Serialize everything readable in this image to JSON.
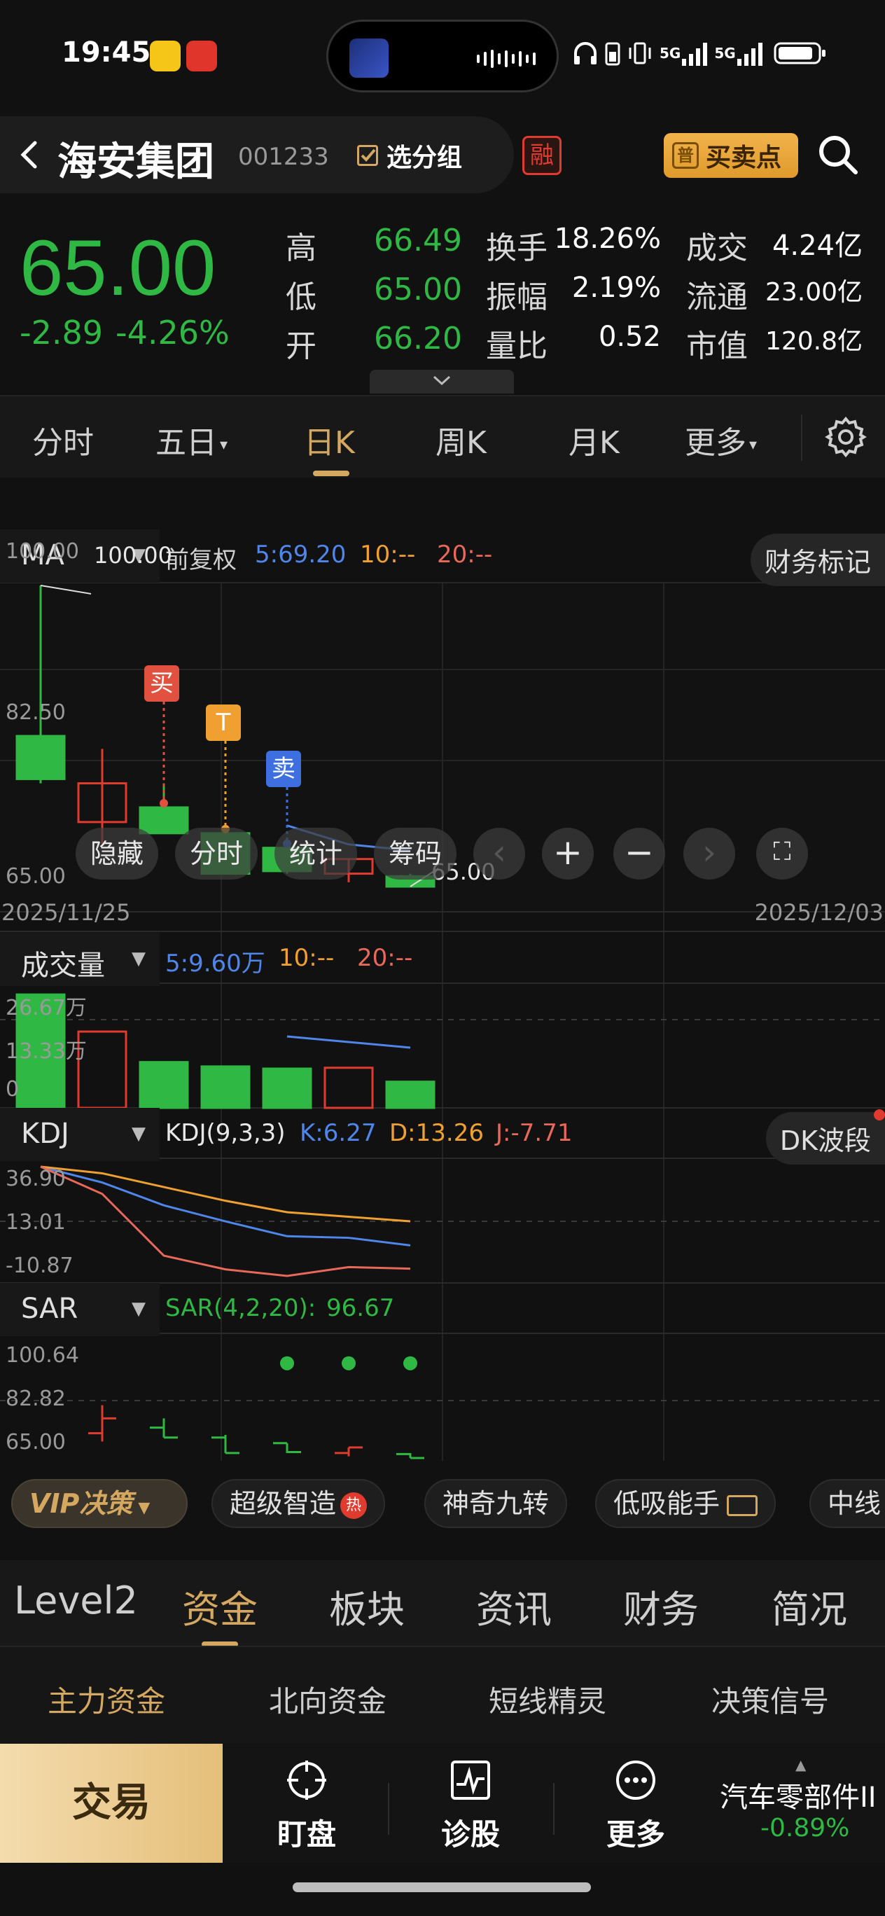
{
  "status_bar": {
    "time": "19:45",
    "signal_1": "5G",
    "signal_2": "5G"
  },
  "header": {
    "back_icon": "chevron-left-icon",
    "stock_name": "海安集团",
    "stock_code": "001233",
    "group_button": "选分组",
    "margin_badge": "融",
    "buy_sell_icon": "普",
    "buy_sell_button": "买卖点",
    "search_icon": "search-icon"
  },
  "quote": {
    "price": "65.00",
    "change": "-2.89",
    "change_pct": "-4.26%",
    "rows": [
      [
        {
          "label": "高",
          "value": "66.49",
          "color": "green"
        },
        {
          "label": "换手",
          "value": "18.26%",
          "color": "white"
        },
        {
          "label": "成交",
          "value": "4.24亿",
          "color": "white"
        }
      ],
      [
        {
          "label": "低",
          "value": "65.00",
          "color": "green"
        },
        {
          "label": "振幅",
          "value": "2.19%",
          "color": "white"
        },
        {
          "label": "流通",
          "value": "23.00亿",
          "color": "white"
        }
      ],
      [
        {
          "label": "开",
          "value": "66.20",
          "color": "green"
        },
        {
          "label": "量比",
          "value": "0.52",
          "color": "white"
        },
        {
          "label": "市值",
          "value": "120.8亿",
          "color": "white"
        }
      ]
    ]
  },
  "period_tabs": [
    "分时",
    "五日",
    "日K",
    "周K",
    "月K",
    "更多"
  ],
  "period_active": "日K",
  "ma": {
    "name": "MA",
    "adjust": "前复权",
    "ma5": "5:69.20",
    "ma10": "10:--",
    "ma20": "20:--",
    "finance_mark_button": "财务标记",
    "y_labels": [
      "100.00",
      "82.50",
      "65.00"
    ],
    "high_label": "100.00",
    "low_label": "65.00",
    "date_start": "2025/11/25",
    "date_end": "2025/12/03",
    "signal_buy": "买",
    "signal_t": "T",
    "signal_sell": "卖"
  },
  "chart_controls": [
    "隐藏",
    "分时",
    "统计",
    "筹码"
  ],
  "volume": {
    "name": "成交量",
    "ma5": "5:9.60万",
    "ma10": "10:--",
    "ma20": "20:--",
    "y_labels": [
      "26.67万",
      "13.33万",
      "0"
    ]
  },
  "kdj": {
    "name": "KDJ",
    "params": "KDJ(9,3,3)",
    "k": "K:6.27",
    "d": "D:13.26",
    "j": "J:-7.71",
    "wave_button": "DK波段",
    "y_labels": [
      "36.90",
      "13.01",
      "-10.87"
    ]
  },
  "sar": {
    "name": "SAR",
    "params": "SAR(4,2,20):",
    "value": "96.67",
    "y_labels": [
      "100.64",
      "82.82",
      "65.00"
    ]
  },
  "strategies": {
    "vip": "VIP决策",
    "items": [
      "超级智造",
      "神奇九转",
      "低吸能手",
      "中线"
    ],
    "hot_badge": "热"
  },
  "section_tabs": [
    "Level2",
    "资金",
    "板块",
    "资讯",
    "财务",
    "简况"
  ],
  "section_active": "资金",
  "sub_tabs": [
    "主力资金",
    "北向资金",
    "短线精灵",
    "决策信号"
  ],
  "bottom_nav": {
    "trade": "交易",
    "items": [
      {
        "label": "盯盘",
        "icon": "crosshair-icon"
      },
      {
        "label": "诊股",
        "icon": "pulse-chart-icon"
      },
      {
        "label": "更多",
        "icon": "more-dots-icon"
      }
    ],
    "sector_name": "汽车零部件II",
    "sector_change": "-0.89%"
  },
  "colors": {
    "up": "#e03b2f",
    "down": "#2fb843",
    "accent": "#d4a860",
    "ma5": "#4f86ea",
    "ma10": "#f0a030",
    "ma20": "#e8685a"
  },
  "chart_data": {
    "type": "candlestick",
    "candles": [
      {
        "open": 82.5,
        "close": 77.5,
        "high": 100.0,
        "low": 77.0
      },
      {
        "open": 72.5,
        "close": 77.0,
        "high": 81.0,
        "low": 70.0
      },
      {
        "open": 74.2,
        "close": 71.2,
        "high": 77.0,
        "low": 71.2
      },
      {
        "open": 71.2,
        "close": 66.5,
        "high": 72.0,
        "low": 66.5
      },
      {
        "open": 69.5,
        "close": 66.8,
        "high": 69.5,
        "low": 66.5
      },
      {
        "open": 66.5,
        "close": 68.2,
        "high": 68.2,
        "low": 65.5
      },
      {
        "open": 66.2,
        "close": 65.0,
        "high": 66.49,
        "low": 65.0
      }
    ],
    "ma5_values": [
      null,
      null,
      null,
      null,
      72.1,
      69.9,
      69.2
    ],
    "volume": [
      26.0,
      17.5,
      10.5,
      9.5,
      9.0,
      9.2,
      6.0
    ],
    "kdj": {
      "K": [
        36.9,
        30.0,
        20.0,
        13.0,
        6.5,
        5.8,
        2.5
      ],
      "D": [
        36.9,
        34.0,
        28.0,
        22.0,
        17.0,
        15.0,
        13.0
      ],
      "J": [
        36.9,
        25.0,
        -2.0,
        -8.0,
        -10.87,
        -7.0,
        -7.71
      ]
    },
    "sar": [
      96.67,
      96.67,
      96.67
    ],
    "signals": [
      {
        "candle": 2,
        "type": "买"
      },
      {
        "candle": 3,
        "type": "T"
      },
      {
        "candle": 4,
        "type": "卖"
      }
    ],
    "ylim_price": [
      65.0,
      100.0
    ],
    "ylim_volume": [
      0,
      26.67
    ],
    "ylim_kdj": [
      -10.87,
      36.9
    ],
    "ylim_sar": [
      65.0,
      100.64
    ]
  }
}
